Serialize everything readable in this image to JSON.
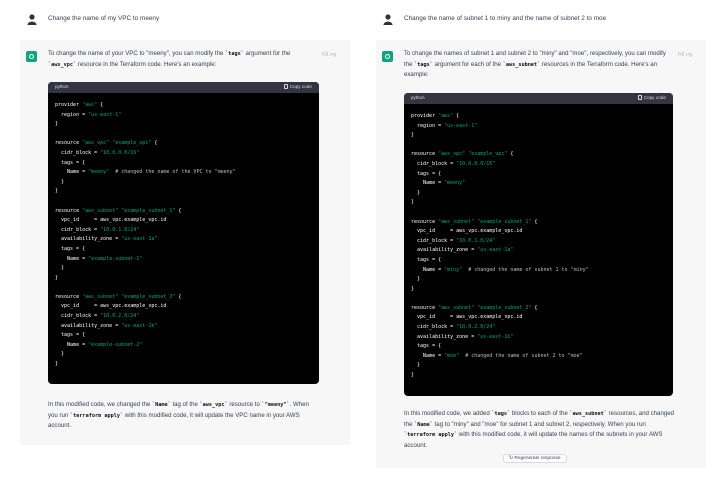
{
  "left": {
    "user_message": "Change the name of my VPC to meeny",
    "intro": [
      {
        "t": "To change the name of your VPC to \"meeny\", you can modify the "
      },
      {
        "t": "`tags`",
        "c": true
      },
      {
        "t": " argument for the "
      },
      {
        "t": "`aws_vpc`",
        "c": true
      },
      {
        "t": " resource in the Terraform code. Here's an example:"
      }
    ],
    "code_lang": "python",
    "copy_label": "Copy code",
    "code_lines": [
      [
        [
          "k",
          "provider "
        ],
        [
          "s",
          "\"aws\""
        ],
        [
          "k",
          " {"
        ]
      ],
      [
        [
          "k",
          "  region = "
        ],
        [
          "s",
          "\"us-east-1\""
        ]
      ],
      [
        [
          "k",
          "}"
        ]
      ],
      [],
      [
        [
          "k",
          "resource "
        ],
        [
          "s",
          "\"aws_vpc\""
        ],
        [
          "k",
          " "
        ],
        [
          "s",
          "\"example_vpc\""
        ],
        [
          "k",
          " {"
        ]
      ],
      [
        [
          "k",
          "  cidr_block = "
        ],
        [
          "s",
          "\"10.0.0.0/16\""
        ]
      ],
      [
        [
          "k",
          "  tags = {"
        ]
      ],
      [
        [
          "k",
          "    Name = "
        ],
        [
          "s",
          "\"meeny\""
        ],
        [
          "cm",
          "  # changed the name of the VPC to \"meeny\""
        ]
      ],
      [
        [
          "k",
          "  }"
        ]
      ],
      [
        [
          "k",
          "}"
        ]
      ],
      [],
      [
        [
          "k",
          "resource "
        ],
        [
          "s",
          "\"aws_subnet\""
        ],
        [
          "k",
          " "
        ],
        [
          "s",
          "\"example_subnet_1\""
        ],
        [
          "k",
          " {"
        ]
      ],
      [
        [
          "k",
          "  vpc_id     = aws_vpc.example_vpc.id"
        ]
      ],
      [
        [
          "k",
          "  cidr_block = "
        ],
        [
          "s",
          "\"10.0.1.0/24\""
        ]
      ],
      [
        [
          "k",
          "  availability_zone = "
        ],
        [
          "s",
          "\"us-east-1a\""
        ]
      ],
      [
        [
          "k",
          "  tags = {"
        ]
      ],
      [
        [
          "k",
          "    Name = "
        ],
        [
          "s",
          "\"example-subnet-1\""
        ]
      ],
      [
        [
          "k",
          "  }"
        ]
      ],
      [
        [
          "k",
          "}"
        ]
      ],
      [],
      [
        [
          "k",
          "resource "
        ],
        [
          "s",
          "\"aws_subnet\""
        ],
        [
          "k",
          " "
        ],
        [
          "s",
          "\"example_subnet_2\""
        ],
        [
          "k",
          " {"
        ]
      ],
      [
        [
          "k",
          "  vpc_id     = aws_vpc.example_vpc.id"
        ]
      ],
      [
        [
          "k",
          "  cidr_block = "
        ],
        [
          "s",
          "\"10.0.2.0/24\""
        ]
      ],
      [
        [
          "k",
          "  availability_zone = "
        ],
        [
          "s",
          "\"us-east-1b\""
        ]
      ],
      [
        [
          "k",
          "  tags = {"
        ]
      ],
      [
        [
          "k",
          "    Name = "
        ],
        [
          "s",
          "\"example-subnet-2\""
        ]
      ],
      [
        [
          "k",
          "  }"
        ]
      ],
      [
        [
          "k",
          "}"
        ]
      ]
    ],
    "outro": [
      {
        "t": "In this modified code, we changed the "
      },
      {
        "t": "`Name`",
        "c": true
      },
      {
        "t": " tag of the "
      },
      {
        "t": "`aws_vpc`",
        "c": true
      },
      {
        "t": " resource to "
      },
      {
        "t": "`\"meeny\"`",
        "c": true
      },
      {
        "t": ". When you run "
      },
      {
        "t": "`terraform apply`",
        "c": true
      },
      {
        "t": " with this modified code, it will update the VPC name in your AWS account."
      }
    ]
  },
  "right": {
    "user_message": "Change the name of subnet 1 to miny and the name of subnet 2 to moe",
    "intro": [
      {
        "t": "To change the names of subnet 1 and subnet 2 to \"miny\" and \"moe\", respectively, you can modify the "
      },
      {
        "t": "`tags`",
        "c": true
      },
      {
        "t": " argument for each of the "
      },
      {
        "t": "`aws_subnet`",
        "c": true
      },
      {
        "t": " resources in the Terraform code. Here's an example:"
      }
    ],
    "code_lang": "python",
    "copy_label": "Copy code",
    "code_lines": [
      [
        [
          "k",
          "provider "
        ],
        [
          "s",
          "\"aws\""
        ],
        [
          "k",
          " {"
        ]
      ],
      [
        [
          "k",
          "  region = "
        ],
        [
          "s",
          "\"us-east-1\""
        ]
      ],
      [
        [
          "k",
          "}"
        ]
      ],
      [],
      [
        [
          "k",
          "resource "
        ],
        [
          "s",
          "\"aws_vpc\""
        ],
        [
          "k",
          " "
        ],
        [
          "s",
          "\"example_vpc\""
        ],
        [
          "k",
          " {"
        ]
      ],
      [
        [
          "k",
          "  cidr_block = "
        ],
        [
          "s",
          "\"10.0.0.0/16\""
        ]
      ],
      [
        [
          "k",
          "  tags = {"
        ]
      ],
      [
        [
          "k",
          "    Name = "
        ],
        [
          "s",
          "\"meeny\""
        ]
      ],
      [
        [
          "k",
          "  }"
        ]
      ],
      [
        [
          "k",
          "}"
        ]
      ],
      [],
      [
        [
          "k",
          "resource "
        ],
        [
          "s",
          "\"aws_subnet\""
        ],
        [
          "k",
          " "
        ],
        [
          "s",
          "\"example_subnet_1\""
        ],
        [
          "k",
          " {"
        ]
      ],
      [
        [
          "k",
          "  vpc_id     = aws_vpc.example_vpc.id"
        ]
      ],
      [
        [
          "k",
          "  cidr_block = "
        ],
        [
          "s",
          "\"10.0.1.0/24\""
        ]
      ],
      [
        [
          "k",
          "  availability_zone = "
        ],
        [
          "s",
          "\"us-east-1a\""
        ]
      ],
      [
        [
          "k",
          "  tags = {"
        ]
      ],
      [
        [
          "k",
          "    Name = "
        ],
        [
          "s",
          "\"miny\""
        ],
        [
          "cm",
          "  # changed the name of subnet 1 to \"miny\""
        ]
      ],
      [
        [
          "k",
          "  }"
        ]
      ],
      [
        [
          "k",
          "}"
        ]
      ],
      [],
      [
        [
          "k",
          "resource "
        ],
        [
          "s",
          "\"aws_subnet\""
        ],
        [
          "k",
          " "
        ],
        [
          "s",
          "\"example_subnet_2\""
        ],
        [
          "k",
          " {"
        ]
      ],
      [
        [
          "k",
          "  vpc_id     = aws_vpc.example_vpc.id"
        ]
      ],
      [
        [
          "k",
          "  cidr_block = "
        ],
        [
          "s",
          "\"10.0.2.0/24\""
        ]
      ],
      [
        [
          "k",
          "  availability_zone = "
        ],
        [
          "s",
          "\"us-east-1b\""
        ]
      ],
      [
        [
          "k",
          "  tags = {"
        ]
      ],
      [
        [
          "k",
          "    Name = "
        ],
        [
          "s",
          "\"moe\""
        ],
        [
          "cm",
          "  # changed the name of subnet 2 to \"moe\""
        ]
      ],
      [
        [
          "k",
          "  }"
        ]
      ],
      [
        [
          "k",
          "}"
        ]
      ]
    ],
    "outro": [
      {
        "t": "In this modified code, we added "
      },
      {
        "t": "`tags`",
        "c": true
      },
      {
        "t": " blocks to each of the "
      },
      {
        "t": "`aws_subnet`",
        "c": true
      },
      {
        "t": " resources, and changed the "
      },
      {
        "t": "`Name`",
        "c": true
      },
      {
        "t": " tag to \"miny\" and \"moe\" for subnet 1 and subnet 2, respectively. When you run "
      },
      {
        "t": "`terraform apply`",
        "c": true
      },
      {
        "t": " with this modified code, it will update the names of the subnets in your AWS account."
      }
    ],
    "regenerate_label": "Regenerate response"
  },
  "icons": {
    "thumbs_up": "thumbs-up-icon",
    "thumbs_down": "thumbs-down-icon",
    "copy": "copy-icon",
    "refresh": "refresh-icon"
  },
  "colors": {
    "assistant_bg": "#f7f7f8",
    "code_bg": "#000000",
    "code_header": "#343541",
    "string": "#00a67d",
    "gpt_green": "#10a37f"
  }
}
